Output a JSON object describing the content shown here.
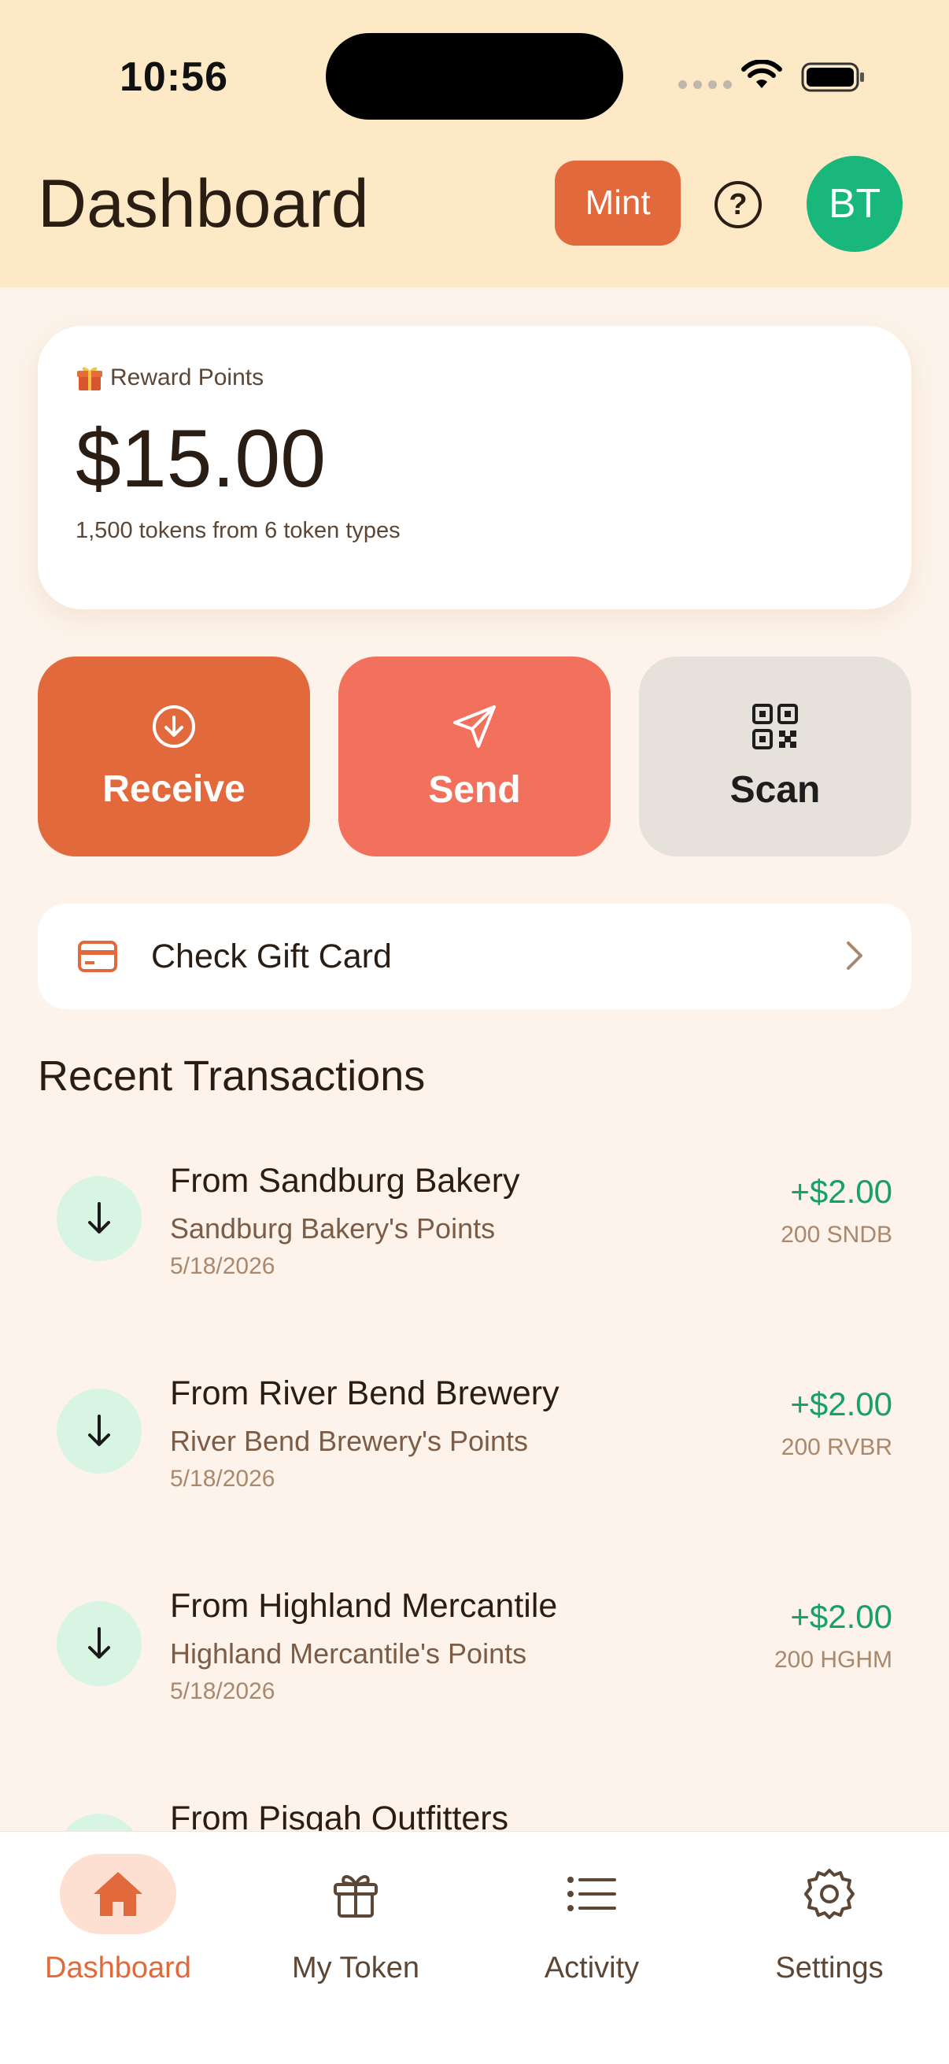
{
  "status_bar": {
    "time": "10:56"
  },
  "header": {
    "title": "Dashboard",
    "mint_label": "Mint",
    "help_icon": "question-circle-icon",
    "avatar_initials": "BT"
  },
  "balance_card": {
    "label": "Reward Points",
    "amount": "$15.00",
    "subtitle": "1,500 tokens from 6 token types"
  },
  "actions": {
    "receive": "Receive",
    "send": "Send",
    "scan": "Scan"
  },
  "gift_card": {
    "label": "Check Gift Card"
  },
  "recent": {
    "title": "Recent Transactions",
    "items": [
      {
        "name": "From Sandburg Bakery",
        "desc": "Sandburg Bakery's Points",
        "date": "5/18/2026",
        "amount": "+$2.00",
        "tokens": "200 SNDB"
      },
      {
        "name": "From River Bend Brewery",
        "desc": "River Bend Brewery's Points",
        "date": "5/18/2026",
        "amount": "+$2.00",
        "tokens": "200 RVBR"
      },
      {
        "name": "From Highland Mercantile",
        "desc": "Highland Mercantile's Points",
        "date": "5/18/2026",
        "amount": "+$2.00",
        "tokens": "200 HGHM"
      },
      {
        "name": "From Pisgah Outfitters",
        "desc": "",
        "date": "",
        "amount": "",
        "tokens": ""
      }
    ]
  },
  "tabs": [
    {
      "label": "Dashboard",
      "icon": "home-icon"
    },
    {
      "label": "My Token",
      "icon": "gift-icon"
    },
    {
      "label": "Activity",
      "icon": "list-icon"
    },
    {
      "label": "Settings",
      "icon": "gear-icon"
    }
  ],
  "colors": {
    "accent": "#e2693b",
    "send": "#f2715c",
    "positive": "#16a06b",
    "header_bg": "#fde9c6"
  }
}
